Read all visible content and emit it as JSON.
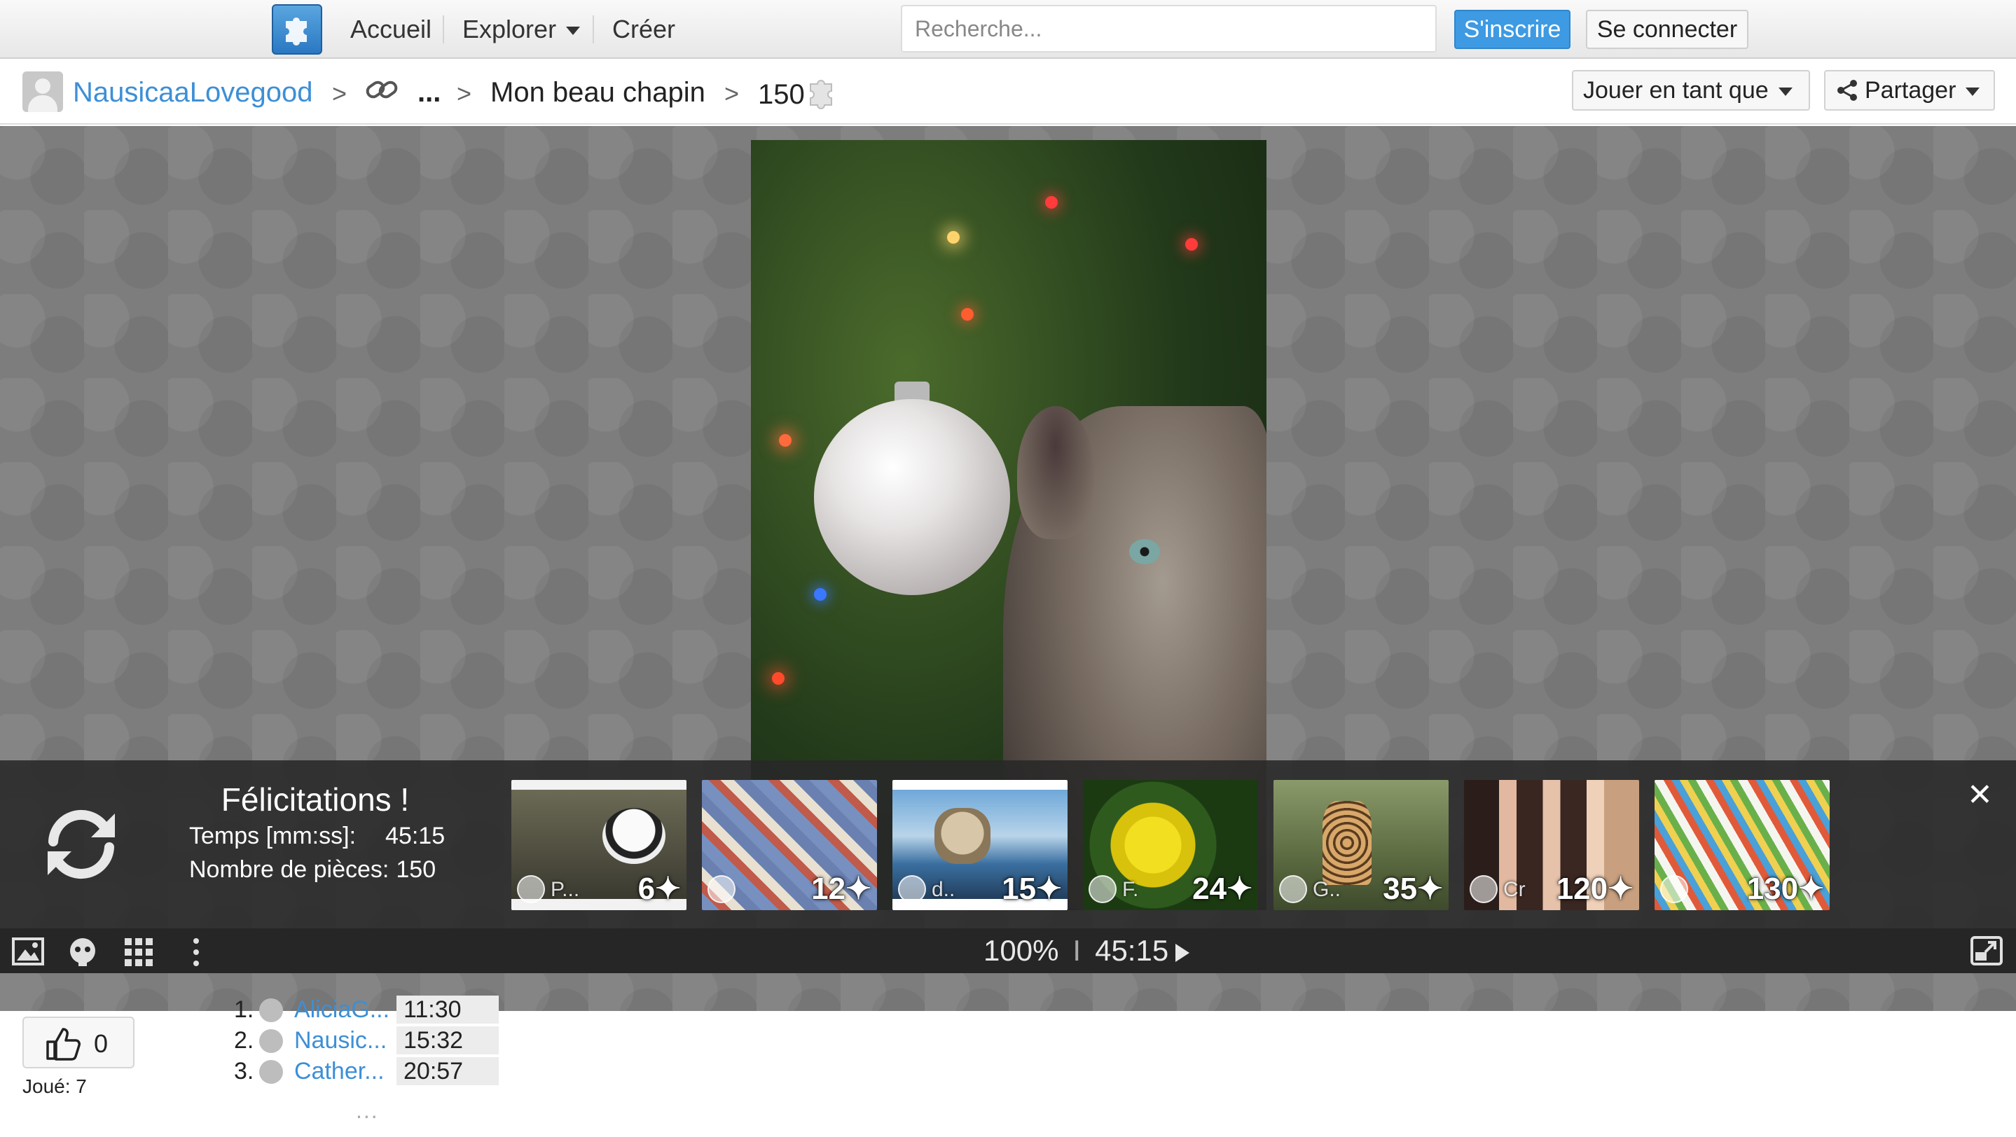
{
  "topbar": {
    "home_label": "Accueil",
    "explore_label": "Explorer",
    "create_label": "Créer",
    "search_placeholder": "Recherche...",
    "signup_label": "S'inscrire",
    "login_label": "Se connecter"
  },
  "breadcrumb": {
    "user": "NausicaaLovegood",
    "ellipsis": "...",
    "puzzle_title": "Mon beau chapin",
    "pieces": "150",
    "play_as_label": "Jouer en tant que",
    "share_label": "Partager"
  },
  "completion": {
    "title": "Félicitations !",
    "time_label": "Temps [mm:ss]:",
    "time_value": "45:15",
    "pieces_label": "Nombre de pièces:",
    "pieces_value": "150",
    "suggestions": [
      {
        "label": "6",
        "user": "P..."
      },
      {
        "label": "12",
        "user": ""
      },
      {
        "label": "15",
        "user": "d.."
      },
      {
        "label": "24",
        "user": "F."
      },
      {
        "label": "35",
        "user": "G.."
      },
      {
        "label": "120",
        "user": "Cr"
      },
      {
        "label": "130",
        "user": ""
      }
    ]
  },
  "toolbar": {
    "zoom": "100%",
    "divider": "I",
    "timer": "45:15"
  },
  "footer": {
    "likes": "0",
    "played": "Joué: 7",
    "scores": [
      {
        "rank": "1.",
        "name": "AliciaG...",
        "time": "11:30"
      },
      {
        "rank": "2.",
        "name": "Nausic...",
        "time": "15:32"
      },
      {
        "rank": "3.",
        "name": "Cather...",
        "time": "20:57"
      }
    ],
    "more": "..."
  },
  "colors": {
    "accent": "#3d9ae3",
    "link": "#3d8fd6",
    "panel_bg": "#282828"
  }
}
